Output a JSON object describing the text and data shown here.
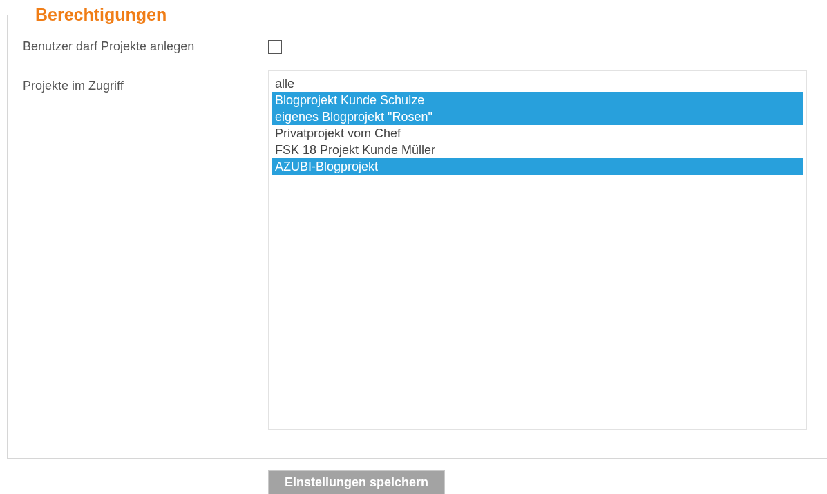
{
  "section": {
    "title": "Berechtigungen"
  },
  "create_projects": {
    "label": "Benutzer darf Projekte anlegen",
    "checked": false
  },
  "projects": {
    "label": "Projekte im Zugriff",
    "options": [
      {
        "label": "alle",
        "selected": false
      },
      {
        "label": "Blogprojekt Kunde Schulze",
        "selected": true
      },
      {
        "label": "eigenes Blogprojekt \"Rosen\"",
        "selected": true
      },
      {
        "label": "Privatprojekt vom Chef",
        "selected": false
      },
      {
        "label": "FSK 18 Projekt Kunde Müller",
        "selected": false
      },
      {
        "label": "AZUBI-Blogprojekt",
        "selected": true
      }
    ]
  },
  "save_button": "Einstellungen speichern"
}
